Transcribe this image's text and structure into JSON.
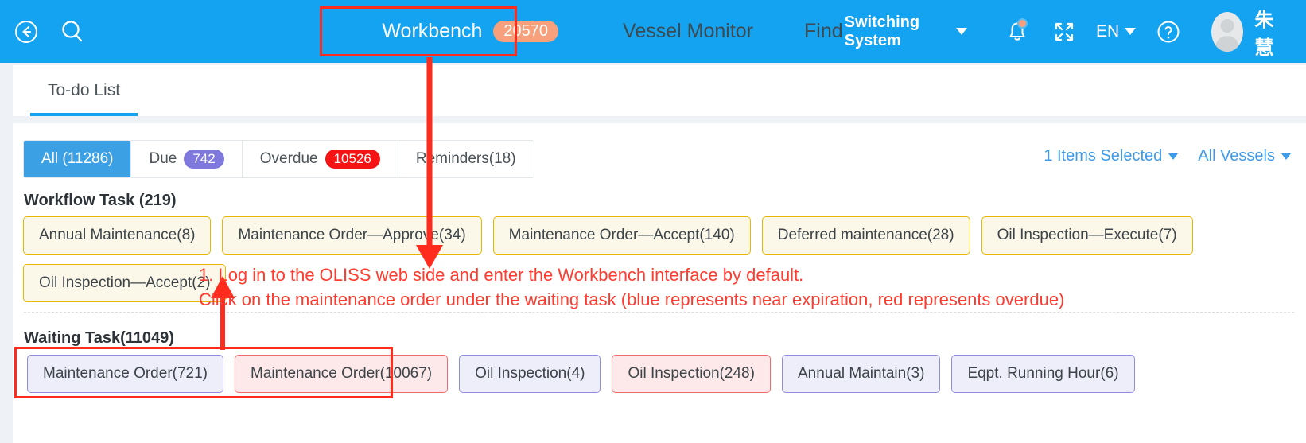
{
  "header": {
    "back_icon": "back-arrow-icon",
    "search_icon": "search-icon",
    "nav": [
      {
        "label": "Workbench",
        "badge": "20570",
        "active": true
      },
      {
        "label": "Vessel Monitor",
        "active": false
      },
      {
        "label": "Find",
        "active": false
      }
    ],
    "switching_system": "Switching System",
    "notification_icon": "bell-icon",
    "fullscreen_icon": "fullscreen-icon",
    "language": "EN",
    "help_icon": "question-circle-icon",
    "avatar_icon": "user-avatar-icon",
    "username": "朱慧"
  },
  "tabs": [
    {
      "label": "To-do List",
      "active": true
    }
  ],
  "filters": [
    {
      "label": "All (11286)",
      "count": null,
      "selected": true
    },
    {
      "label": "Due",
      "count": "742",
      "count_color": "purple",
      "selected": false
    },
    {
      "label": "Overdue",
      "count": "10526",
      "count_color": "red",
      "selected": false
    },
    {
      "label": "Reminders(18)",
      "count": null,
      "selected": false
    }
  ],
  "right_links": [
    {
      "label": "1 Items Selected"
    },
    {
      "label": "All Vessels"
    }
  ],
  "workflow_task": {
    "title": "Workflow Task (219)",
    "row1": [
      {
        "label": "Annual Maintenance(8)",
        "style": "yellow"
      },
      {
        "label": "Maintenance Order—Approve(34)",
        "style": "yellow"
      },
      {
        "label": "Maintenance Order—Accept(140)",
        "style": "yellow"
      },
      {
        "label": "Deferred maintenance(28)",
        "style": "yellow"
      },
      {
        "label": "Oil Inspection—Execute(7)",
        "style": "yellow"
      }
    ],
    "row2": [
      {
        "label": "Oil Inspection—Accept(2)",
        "style": "yellow"
      }
    ]
  },
  "waiting_task": {
    "title": "Waiting Task(11049)",
    "row1": [
      {
        "label": "Maintenance Order(721)",
        "style": "blue"
      },
      {
        "label": "Maintenance Order(10067)",
        "style": "red"
      },
      {
        "label": "Oil Inspection(4)",
        "style": "blue"
      },
      {
        "label": "Oil Inspection(248)",
        "style": "red"
      },
      {
        "label": "Annual Maintain(3)",
        "style": "blue"
      },
      {
        "label": "Eqpt. Running Hour(6)",
        "style": "blue"
      }
    ]
  },
  "annotations": {
    "line1": "1. Log in to the OLISS web side and enter the Workbench interface by default.",
    "line2": "Click on the maintenance order under the waiting task (blue represents near expiration, red represents overdue)"
  },
  "colors": {
    "header_blue": "#13A3F0",
    "accent_blue": "#3BA0E4",
    "annotation_red": "#FF3B2F",
    "badge_orange": "#F7A07B",
    "count_purple": "#7F79DE",
    "count_red": "#F41414",
    "chip_yellow_border": "#E8B705",
    "chip_blue_border": "#8E8BE0",
    "chip_red_border": "#F26B6B"
  }
}
